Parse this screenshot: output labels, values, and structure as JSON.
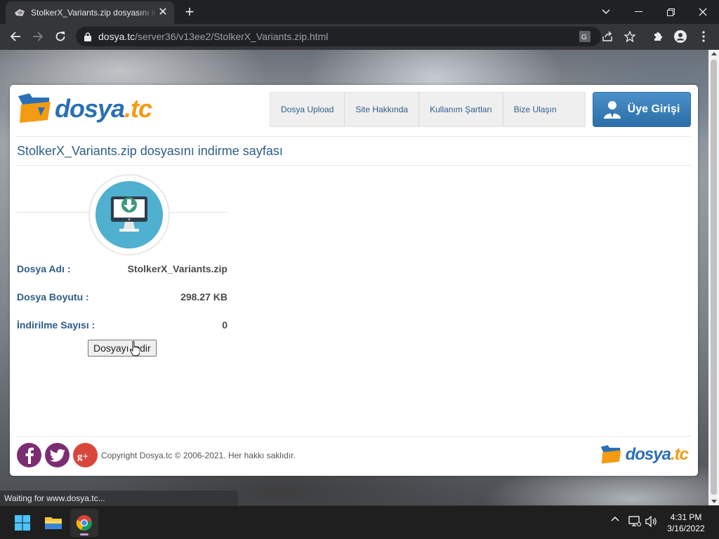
{
  "browser": {
    "tab_title": "StolkerX_Variants.zip dosyasını indirme sayfası",
    "url_host": "dosya.tc",
    "url_path": "/server36/v13ee2/StolkerX_Variants.zip.html",
    "status_text": "Waiting for www.dosya.tc..."
  },
  "site": {
    "logo_part1": "dosya",
    "logo_part2": ".tc",
    "nav": [
      {
        "label": "Dosya Upload"
      },
      {
        "label": "Site Hakkında"
      },
      {
        "label": "Kullanım Şartları"
      },
      {
        "label": "Bize Ulaşın"
      }
    ],
    "member_button": "Üye Girişi"
  },
  "page": {
    "title": "StolkerX_Variants.zip dosyasını indirme sayfası",
    "file_name_label": "Dosya Adı :",
    "file_name_value": "StolkerX_Variants.zip",
    "file_size_label": "Dosya Boyutu :",
    "file_size_value": "298.27 KB",
    "download_count_label": "İndirilme Sayısı :",
    "download_count_value": "0",
    "download_button": "Dosyayı İndir"
  },
  "footer": {
    "copyright": "Copyright Dosya.tc © 2006-2021. Her hakkı saklıdır.",
    "social": [
      "facebook-icon",
      "twitter-icon",
      "google-plus-icon"
    ]
  },
  "taskbar": {
    "time": "4:31 PM",
    "date": "3/16/2022"
  },
  "colors": {
    "brand_blue": "#2d5d8a",
    "brand_orange": "#f39c12",
    "download_circle": "#4fb0cf",
    "facebook": "#7b2d73",
    "twitter": "#7b2d73",
    "google": "#d9473c"
  }
}
